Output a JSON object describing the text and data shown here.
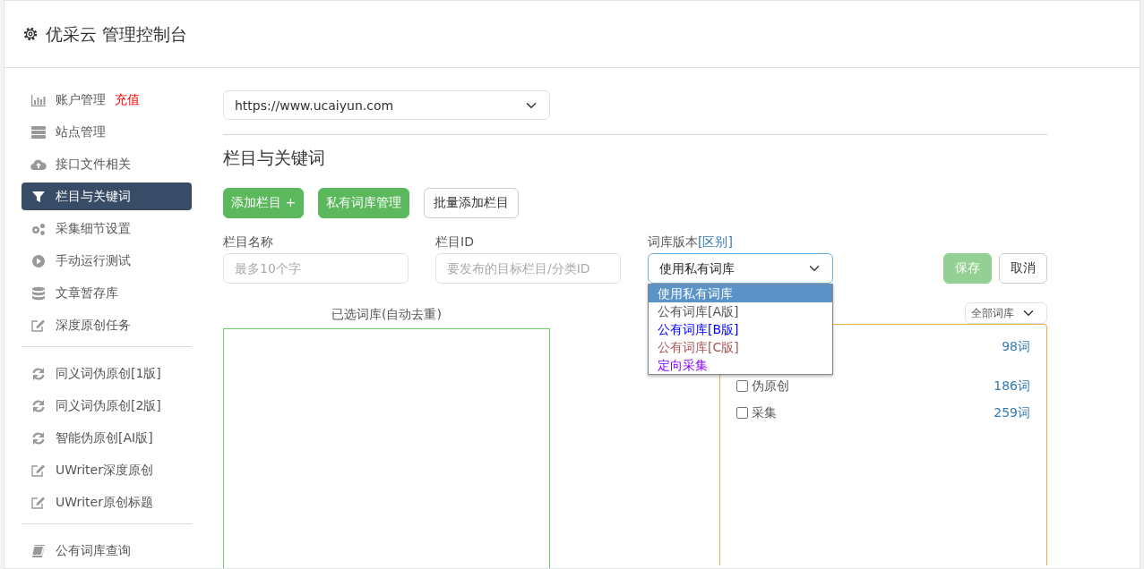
{
  "header": {
    "title": "优采云 管理控制台"
  },
  "sidebar": {
    "groups": [
      {
        "items": [
          {
            "label": "账户管理",
            "badge": "充值",
            "selected": false
          },
          {
            "label": "站点管理",
            "selected": false
          },
          {
            "label": "接口文件相关",
            "selected": false
          },
          {
            "label": "栏目与关键词",
            "selected": true
          },
          {
            "label": "采集细节设置",
            "selected": false
          },
          {
            "label": "手动运行测试",
            "selected": false
          },
          {
            "label": "文章暂存库",
            "selected": false
          },
          {
            "label": "深度原创任务",
            "selected": false
          }
        ]
      },
      {
        "items": [
          {
            "label": "同义词伪原创[1版]",
            "selected": false
          },
          {
            "label": "同义词伪原创[2版]",
            "selected": false
          },
          {
            "label": "智能伪原创[AI版]",
            "selected": false
          },
          {
            "label": "UWriter深度原创",
            "selected": false
          },
          {
            "label": "UWriter原创标题",
            "selected": false
          }
        ]
      },
      {
        "items": [
          {
            "label": "公有词库查询",
            "selected": false
          }
        ]
      }
    ]
  },
  "site_select": {
    "value": "https://www.ucaiyun.com"
  },
  "section_title": "栏目与关键词",
  "toolbar": [
    {
      "label": "添加栏目 +",
      "kind": "primary"
    },
    {
      "label": "私有词库管理",
      "kind": "primary"
    },
    {
      "label": "批量添加栏目",
      "kind": "outline"
    }
  ],
  "form": {
    "name_label": "栏目名称",
    "name_placeholder": "最多10个字",
    "id_label": "栏目ID",
    "id_placeholder": "要发布的目标栏目/分类ID",
    "version_label": "词库版本",
    "version_link": "[区别]",
    "version_value": "使用私有词库",
    "save": "保存",
    "cancel": "取消"
  },
  "version_options": [
    {
      "label": "使用私有词库",
      "selected": true
    },
    {
      "label": "公有词库[A版]",
      "selected": false,
      "color": "#555555"
    },
    {
      "label": "公有词库[B版]",
      "selected": false,
      "color": "#0000ff"
    },
    {
      "label": "公有词库[C版]",
      "selected": false,
      "color": "#aa5555"
    },
    {
      "label": "定向采集",
      "selected": false,
      "color": "#8800ff"
    }
  ],
  "selected_panel": {
    "title": "已选词库(自动去重)"
  },
  "library_panel": {
    "filter": "全部词库",
    "rows": [
      {
        "count": "98词"
      },
      {
        "label": "伪原创",
        "count": "186词",
        "checked": false
      },
      {
        "label": "采集",
        "count": "259词",
        "checked": false
      }
    ]
  }
}
